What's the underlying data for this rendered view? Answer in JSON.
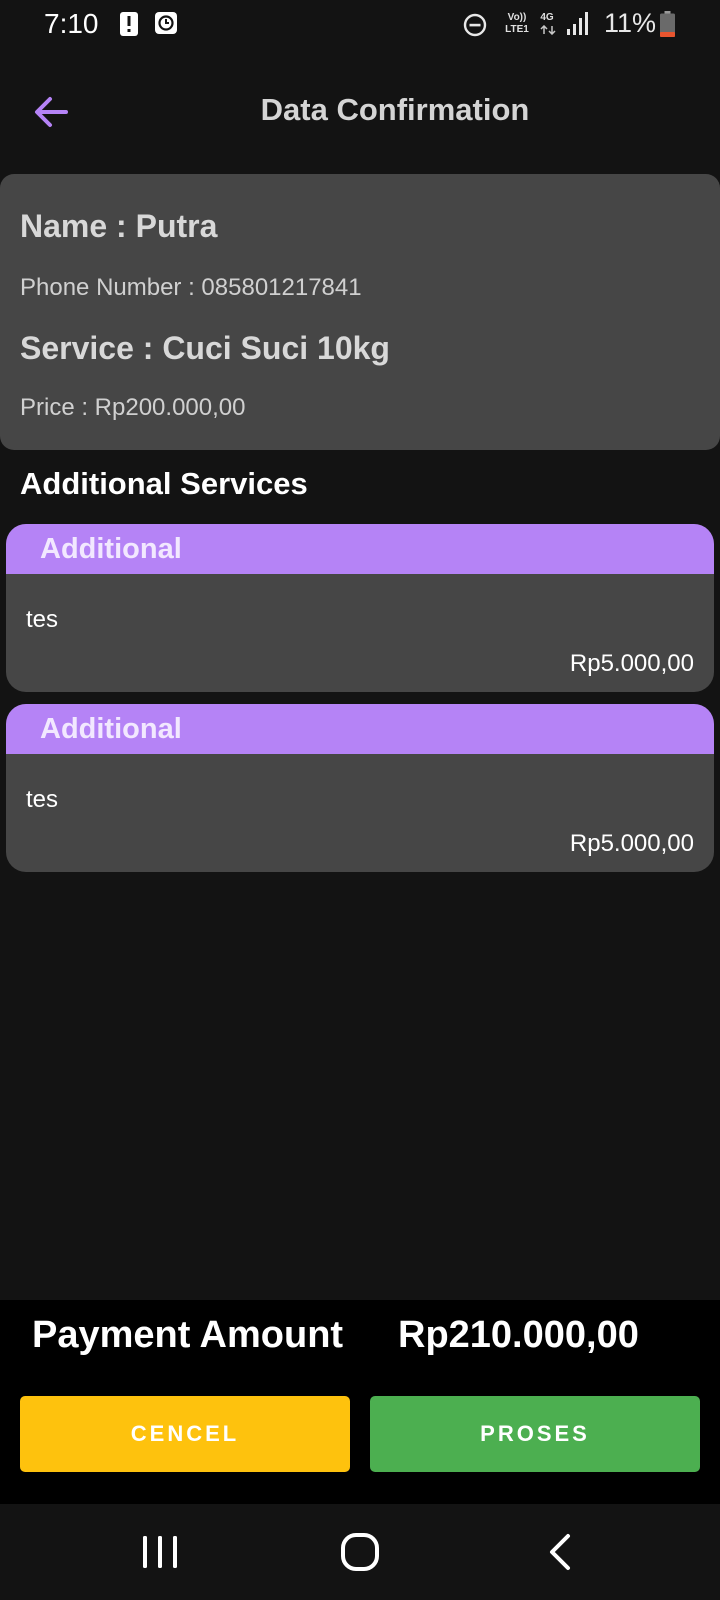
{
  "status_bar": {
    "time": "7:10",
    "volte_label": "Vo))",
    "lte_label": "LTE1",
    "network_label": "4G",
    "battery_percent": "11%",
    "icons": [
      "alert-icon",
      "clock-icon",
      "dnd-icon",
      "signal-icon",
      "battery-icon"
    ]
  },
  "app_bar": {
    "title": "Data Confirmation",
    "back_icon": "arrow-left-icon",
    "accent_color": "#b583f6"
  },
  "customer": {
    "name_line": "Name : Putra",
    "phone_line": "Phone Number : 085801217841",
    "service_line": "Service : Cuci Suci 10kg",
    "price_line": "Price : Rp200.000,00"
  },
  "additional": {
    "section_title": "Additional Services",
    "items": [
      {
        "header": "Additional",
        "name": "tes",
        "price": "Rp5.000,00"
      },
      {
        "header": "Additional",
        "name": "tes",
        "price": "Rp5.000,00"
      }
    ]
  },
  "payment": {
    "label": "Payment Amount",
    "amount": "Rp210.000,00"
  },
  "actions": {
    "cancel_label": "CENCEL",
    "proses_label": "PROSES",
    "cancel_color": "#fec20d",
    "proses_color": "#4caf50"
  },
  "nav_bar": {
    "icons": [
      "recent-apps-icon",
      "home-icon",
      "back-nav-icon"
    ]
  }
}
